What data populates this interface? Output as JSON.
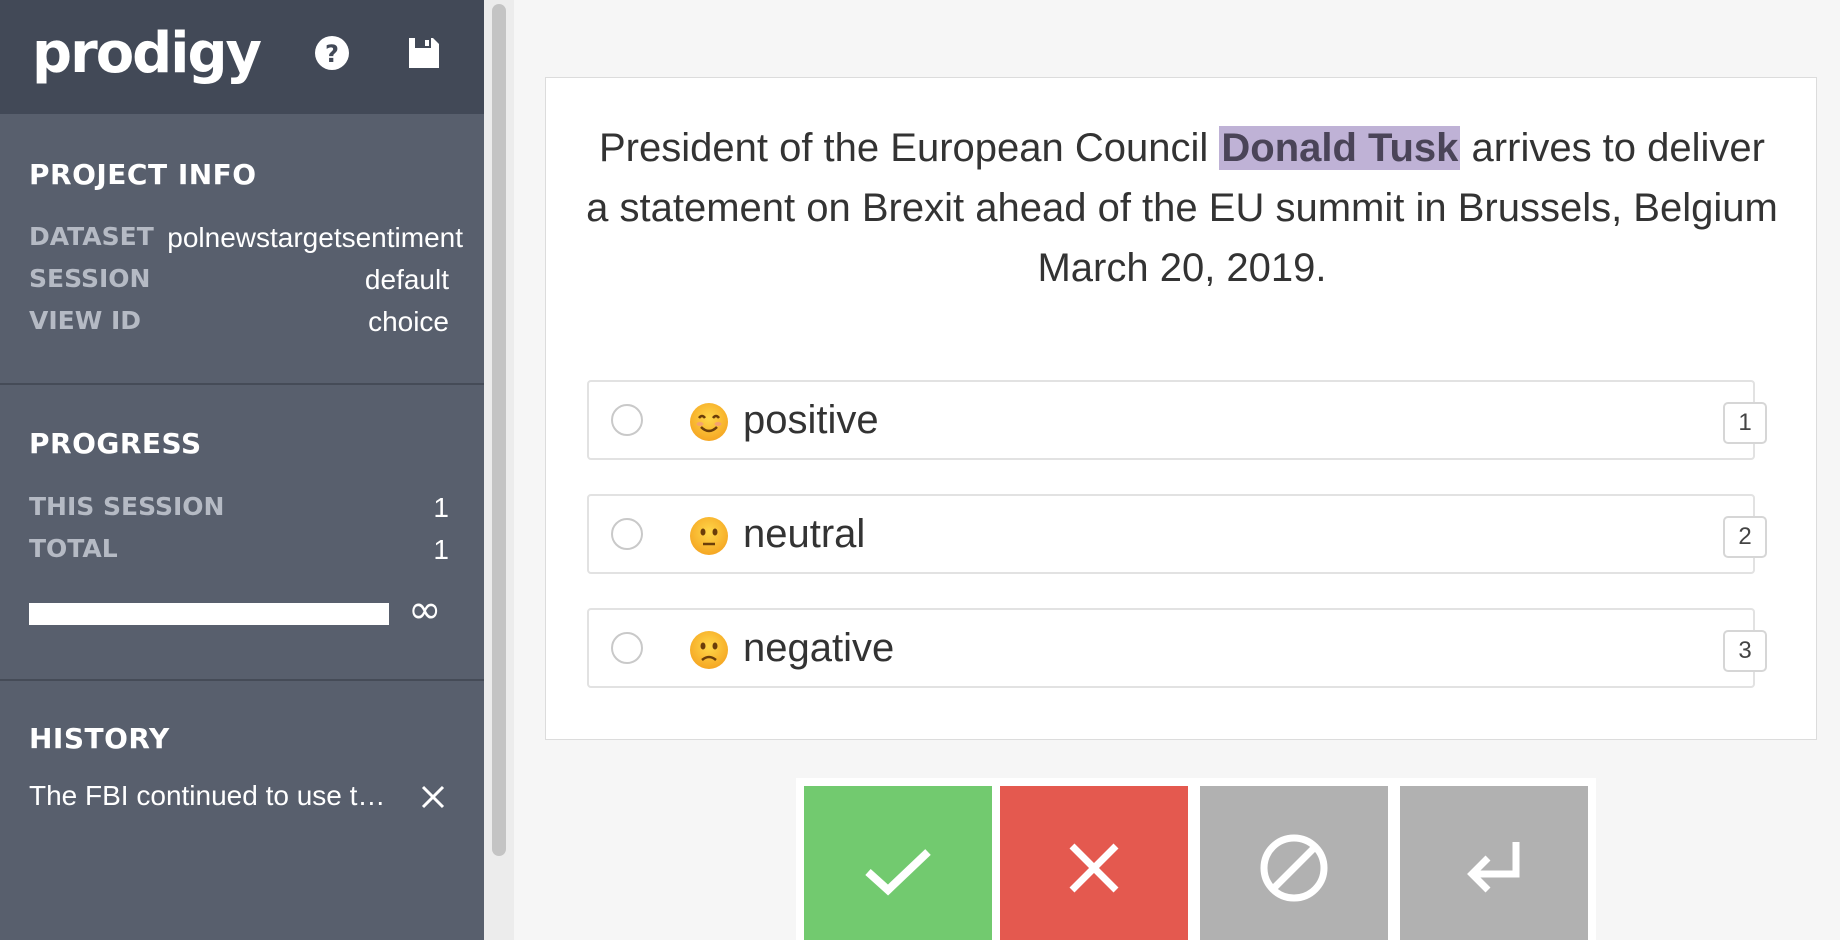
{
  "app": {
    "logo": "prodigy"
  },
  "header": {
    "icons": [
      "help-icon",
      "save-icon"
    ]
  },
  "project_info": {
    "title": "PROJECT INFO",
    "rows": [
      {
        "key": "DATASET",
        "value": "polnewstargetsentiment"
      },
      {
        "key": "SESSION",
        "value": "default"
      },
      {
        "key": "VIEW ID",
        "value": "choice"
      }
    ]
  },
  "progress": {
    "title": "PROGRESS",
    "rows": [
      {
        "key": "THIS SESSION",
        "value": "1"
      },
      {
        "key": "TOTAL",
        "value": "1"
      }
    ],
    "bar_fraction": 1.0,
    "bar_end_symbol": "∞"
  },
  "history": {
    "title": "HISTORY",
    "items": [
      {
        "text": "The FBI continued to use th..."
      }
    ]
  },
  "task": {
    "text_before": "President of the European Council ",
    "entity": "Donald Tusk",
    "text_after": " arrives to deliver a statement on Brexit ahead of the EU summit in Brussels, Belgium March 20, 2019.",
    "entity_color": "#bfb2d6"
  },
  "options": [
    {
      "label": "positive",
      "emoji": "smiling-face-icon",
      "key": "1"
    },
    {
      "label": "neutral",
      "emoji": "neutral-face-icon",
      "key": "2"
    },
    {
      "label": "negative",
      "emoji": "frowning-face-icon",
      "key": "3"
    }
  ],
  "actions": {
    "accept_color": "#72ca6f",
    "reject_color": "#e4594f",
    "ignore_color": "#b1b1b1",
    "undo_color": "#b1b1b1",
    "icons": [
      "checkmark-icon",
      "cross-icon",
      "ignore-icon",
      "undo-icon"
    ]
  }
}
